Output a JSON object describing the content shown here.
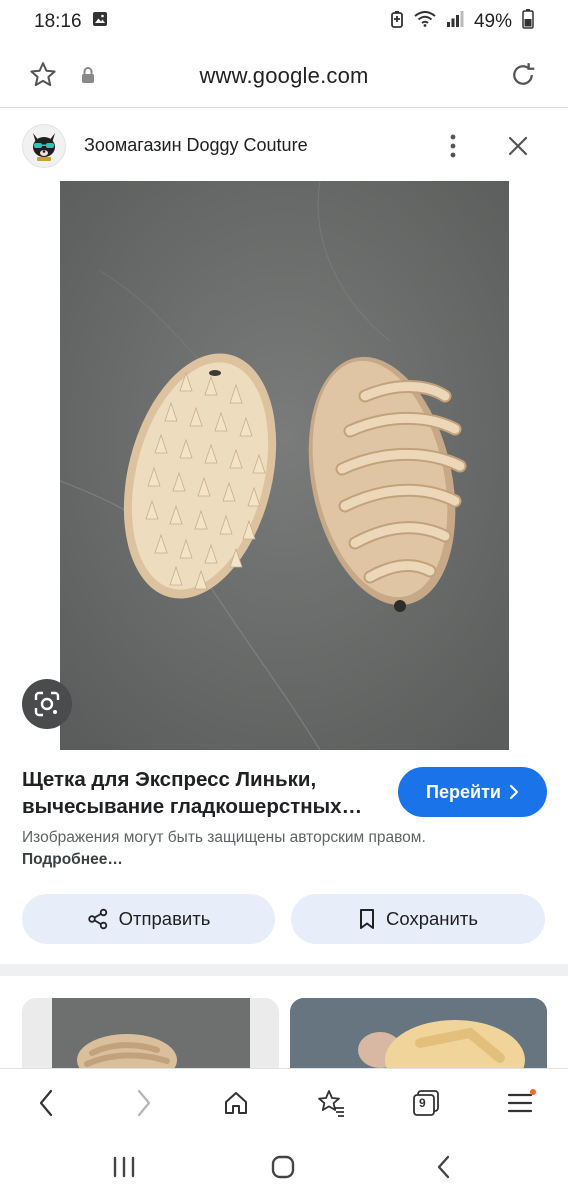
{
  "status_bar": {
    "time": "18:16",
    "battery": "49%"
  },
  "browser": {
    "url": "www.google.com",
    "tab_count": "9"
  },
  "source": {
    "name": "Зоомагазин Doggy Couture"
  },
  "result": {
    "title_line1": "Щетка для Экспресс Линьки,",
    "title_line2": "вычесывание гладкошерстных…",
    "goto_label": "Перейти",
    "notice_text": "Изображения могут быть защищены авторским правом.",
    "notice_link": "Подробнее…",
    "share_label": "Отправить",
    "save_label": "Сохранить"
  },
  "colors": {
    "accent": "#1a73e8",
    "action_bg": "#e8eef9",
    "notification_dot": "#f06b24"
  },
  "icons": {
    "status": [
      "gallery-icon",
      "battery-saver-icon",
      "wifi-icon",
      "signal-icon",
      "battery-icon"
    ],
    "url_bar": [
      "star-icon",
      "lock-icon",
      "reload-icon"
    ],
    "nav": [
      "back-icon",
      "forward-icon",
      "home-icon",
      "bookmarks-icon",
      "tabs-icon",
      "menu-icon"
    ],
    "system": [
      "recent-apps-icon",
      "home-button-icon",
      "system-back-icon"
    ]
  }
}
